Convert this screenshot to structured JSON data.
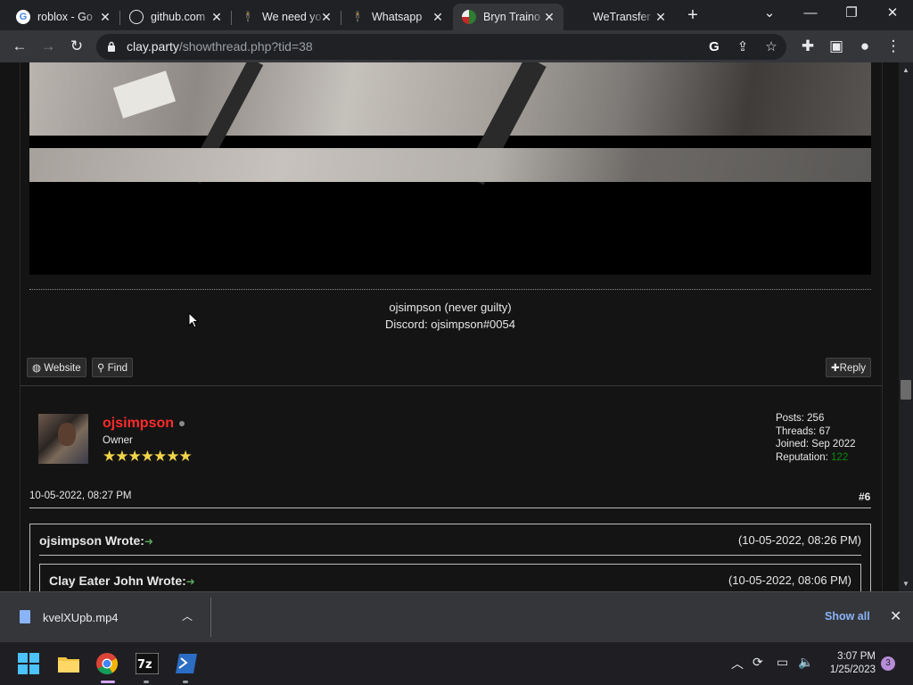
{
  "tabs": [
    {
      "title": "roblox - Go",
      "icon": "google-icon",
      "active": false
    },
    {
      "title": "github.com",
      "icon": "globe-icon",
      "active": false
    },
    {
      "title": "We need yo",
      "icon": "person-icon",
      "active": false
    },
    {
      "title": "Whatsapp ",
      "icon": "person-icon",
      "active": false
    },
    {
      "title": "Bryn Traino",
      "icon": "flag-icon",
      "active": true
    },
    {
      "title": "WeTransfer",
      "icon": "none",
      "active": false
    }
  ],
  "toolbar": {
    "url_host": "clay.party",
    "url_path": "/showthread.php?tid=38"
  },
  "signature": {
    "line1": "ojsimpson (never guilty)",
    "line2": "Discord: ojsimpson#0054"
  },
  "post_buttons": {
    "website": "Website",
    "find": "Find",
    "reply": "Reply"
  },
  "author": {
    "username": "ojsimpson",
    "role": "Owner",
    "stars": "★★★★★★★",
    "posts": "Posts: 256",
    "threads": "Threads: 67",
    "joined": "Joined: Sep 2022",
    "reputation_label": "Reputation:",
    "reputation_value": "122"
  },
  "post": {
    "date": "10-05-2022, 08:27 PM",
    "number": "#6"
  },
  "quote": {
    "author": "ojsimpson Wrote:",
    "date": "(10-05-2022, 08:26 PM)",
    "inner_author": "Clay Eater John Wrote:",
    "inner_date": "(10-05-2022, 08:06 PM)"
  },
  "download_bar": {
    "filename": "kvelXUpb.mp4",
    "show_all": "Show all"
  },
  "taskbar": {
    "time": "3:07 PM",
    "date": "1/25/2023",
    "notification_count": "3"
  },
  "colors": {
    "username": "#ff2b2b",
    "reputation": "#0a8a0a",
    "accent_link": "#8ab4f8"
  }
}
